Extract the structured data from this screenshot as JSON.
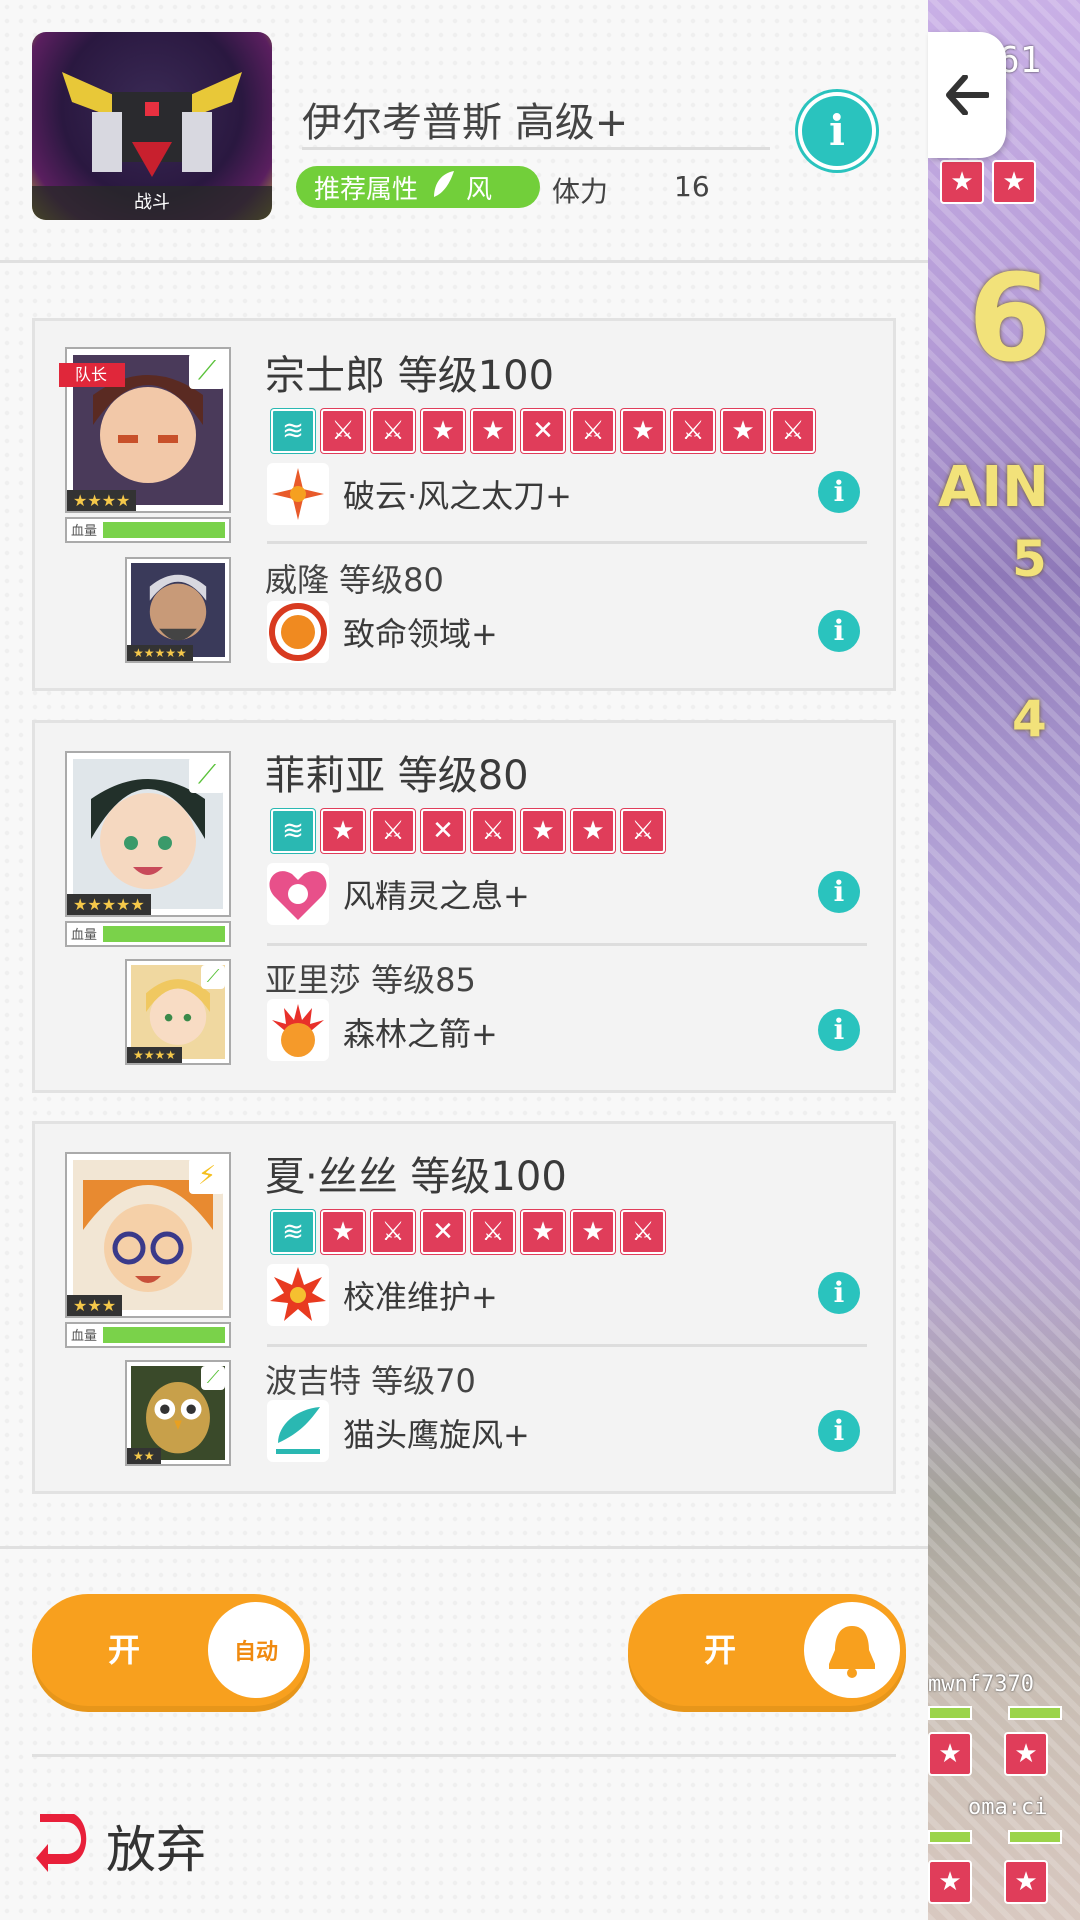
{
  "quest": {
    "title": "伊尔考普斯 高级+",
    "thumb_tag": "战斗",
    "recommended_label": "推荐属性",
    "recommended_element": "风",
    "stamina_label": "体力",
    "stamina_value": "16"
  },
  "teams": [
    {
      "main": {
        "name": "宗士郎 等级100",
        "leader_tag": "队长",
        "stars": "★★★★",
        "hp_label": "血量",
        "element": "wind",
        "cards": [
          "teal",
          "sword",
          "sword",
          "star",
          "star",
          "slash",
          "sword",
          "star",
          "sword",
          "star",
          "sword"
        ],
        "skill": "破云·风之太刀+",
        "skill_icon": "compass-icon"
      },
      "sub": {
        "name": "威隆 等级80",
        "stars": "★★★★★",
        "skill": "致命领域+",
        "skill_icon": "target-ring-icon"
      }
    },
    {
      "main": {
        "name": "菲莉亚 等级80",
        "stars": "★★★★★",
        "hp_label": "血量",
        "element": "wind",
        "cards": [
          "teal",
          "star",
          "sword",
          "slash",
          "sword",
          "star",
          "star",
          "sword"
        ],
        "skill": "风精灵之息+",
        "skill_icon": "heart-icon"
      },
      "sub": {
        "name": "亚里莎 等级85",
        "stars": "★★★★",
        "skill": "森林之箭+",
        "skill_icon": "burst-orb-icon"
      }
    },
    {
      "main": {
        "name": "夏·丝丝 等级100",
        "stars": "★★★",
        "hp_label": "血量",
        "element": "thunder",
        "cards": [
          "teal",
          "star",
          "sword",
          "slash",
          "sword",
          "star",
          "star",
          "sword"
        ],
        "skill": "校准维护+",
        "skill_icon": "explosion-icon"
      },
      "sub": {
        "name": "波吉特 等级70",
        "stars": "★★",
        "skill": "猫头鹰旋风+",
        "skill_icon": "wind-feather-icon"
      }
    }
  ],
  "toggles": {
    "auto": {
      "state": "开",
      "knob_label": "自动"
    },
    "notify": {
      "state": "开",
      "knob_icon": "bell-icon"
    }
  },
  "abandon_label": "放弃",
  "backdrop": {
    "top_number": "61",
    "combo_big": "6",
    "chain_text": "AIN",
    "chain_5": "5",
    "chain_4": "4",
    "player1": "mwnf7370",
    "player2": "oma:ci"
  },
  "colors": {
    "accent_teal": "#2ac3be",
    "toggle_orange": "#f8a01e",
    "element_green": "#72cf3a",
    "card_red": "#e03d5a"
  }
}
